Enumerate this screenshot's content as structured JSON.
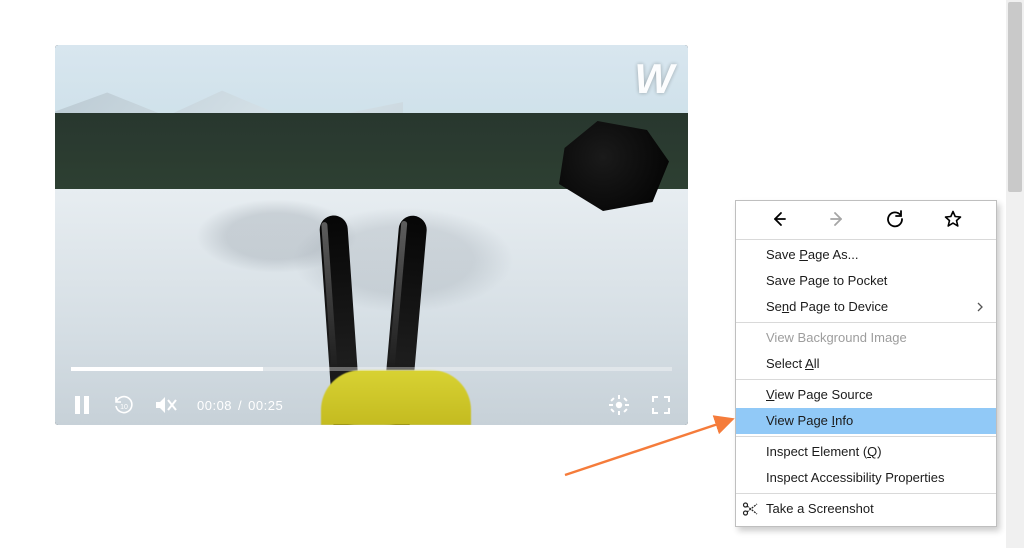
{
  "player": {
    "current_time": "00:08",
    "duration": "00:25",
    "time_sep": "/",
    "progress_pct": 32,
    "watermark_glyph": "W"
  },
  "context_menu": {
    "save_as": {
      "pre": "Save ",
      "u": "P",
      "post": "age As..."
    },
    "save_pocket": {
      "text": "Save Page to Pocket"
    },
    "send_device": {
      "pre": "Se",
      "u": "n",
      "post": "d Page to Device"
    },
    "view_bg": {
      "text": "View Background Image"
    },
    "select_all": {
      "pre": "Select ",
      "u": "A",
      "post": "ll"
    },
    "view_source": {
      "pre": "",
      "u": "V",
      "post": "iew Page Source"
    },
    "view_info": {
      "pre": "View Page ",
      "u": "I",
      "post": "nfo"
    },
    "inspect_el": {
      "pre": "Inspect Element (",
      "u": "Q",
      "post": ")"
    },
    "inspect_acc": {
      "text": "Inspect Accessibility Properties"
    },
    "screenshot": {
      "text": "Take a Screenshot"
    }
  }
}
